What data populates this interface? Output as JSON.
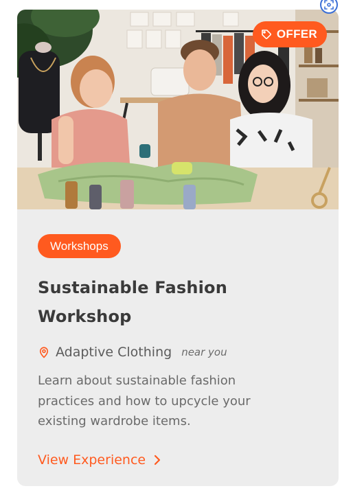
{
  "badge": {
    "label": "OFFER"
  },
  "card": {
    "category": "Workshops",
    "title_line1": "Sustainable Fashion",
    "title_line2": "Workshop",
    "location": "Adaptive Clothing",
    "proximity": "near you",
    "description_lines": [
      "Learn about sustainable fashion",
      "practices and how to upcycle your",
      "existing wardrobe items."
    ],
    "cta_label": "View Experience"
  },
  "colors": {
    "accent": "#ff5a1f",
    "card_bg": "#ededed",
    "title": "#3a3a3a",
    "body_text": "#6a6a6a"
  },
  "icons": {
    "badge": "tag-icon",
    "location": "map-pin-icon",
    "cta": "chevron-right-icon",
    "corner": "screenshot-capture-icon"
  }
}
